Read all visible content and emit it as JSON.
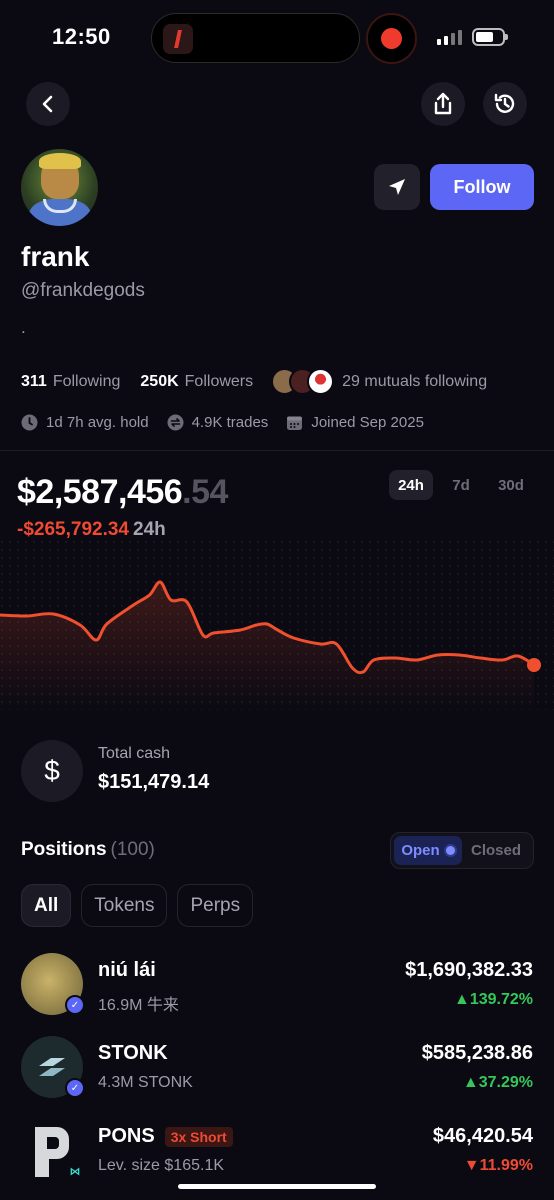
{
  "status_bar": {
    "time": "12:50"
  },
  "profile": {
    "name": "frank",
    "handle": "@frankdegods",
    "bio": ".",
    "follow_label": "Follow",
    "following_count": "311",
    "following_label": "Following",
    "followers_count": "250K",
    "followers_label": "Followers",
    "mutuals_text": "29 mutuals following",
    "avg_hold": "1d 7h avg. hold",
    "trades": "4.9K trades",
    "joined": "Joined Sep 2025"
  },
  "portfolio": {
    "balance_main": "$2,587,456",
    "balance_cents": ".54",
    "change_value": "-$265,792.34",
    "change_period": "24h",
    "ranges": [
      "24h",
      "7d",
      "30d"
    ],
    "active_range": "24h"
  },
  "chart_data": {
    "type": "line",
    "x": [
      0,
      0.05,
      0.1,
      0.15,
      0.18,
      0.2,
      0.25,
      0.28,
      0.3,
      0.32,
      0.35,
      0.38,
      0.4,
      0.45,
      0.48,
      0.5,
      0.52,
      0.55,
      0.6,
      0.63,
      0.66,
      0.68,
      0.7,
      0.74,
      0.78,
      0.82,
      0.86,
      0.9,
      0.94,
      0.97,
      1.0
    ],
    "values": [
      0.65,
      0.64,
      0.66,
      0.55,
      0.4,
      0.56,
      0.75,
      0.85,
      0.98,
      0.8,
      0.78,
      0.45,
      0.47,
      0.5,
      0.55,
      0.56,
      0.5,
      0.42,
      0.36,
      0.36,
      0.12,
      0.08,
      0.2,
      0.22,
      0.2,
      0.25,
      0.25,
      0.22,
      0.2,
      0.24,
      0.15
    ],
    "ylim": [
      0,
      1
    ],
    "line_color": "#f0502e"
  },
  "cash": {
    "label": "Total cash",
    "value": "$151,479.14",
    "icon": "$"
  },
  "positions": {
    "title": "Positions",
    "count": "(100)",
    "open_label": "Open",
    "closed_label": "Closed",
    "filters": [
      "All",
      "Tokens",
      "Perps"
    ],
    "items": [
      {
        "name": "niú lái",
        "sub": "16.9M 牛来",
        "value": "$1,690,382.33",
        "change": "▲139.72%",
        "direction": "up"
      },
      {
        "name": "STONK",
        "sub": "4.3M STONK",
        "value": "$585,238.86",
        "change": "▲37.29%",
        "direction": "up"
      },
      {
        "name": "PONS",
        "tag": "3x Short",
        "sub": "Lev. size $165.1K",
        "value": "$46,420.54",
        "change": "▼11.99%",
        "direction": "down"
      }
    ]
  },
  "colors": {
    "accent": "#5d67f5",
    "positive": "#35c759",
    "negative": "#ef4a32",
    "background": "#0b0a13"
  }
}
